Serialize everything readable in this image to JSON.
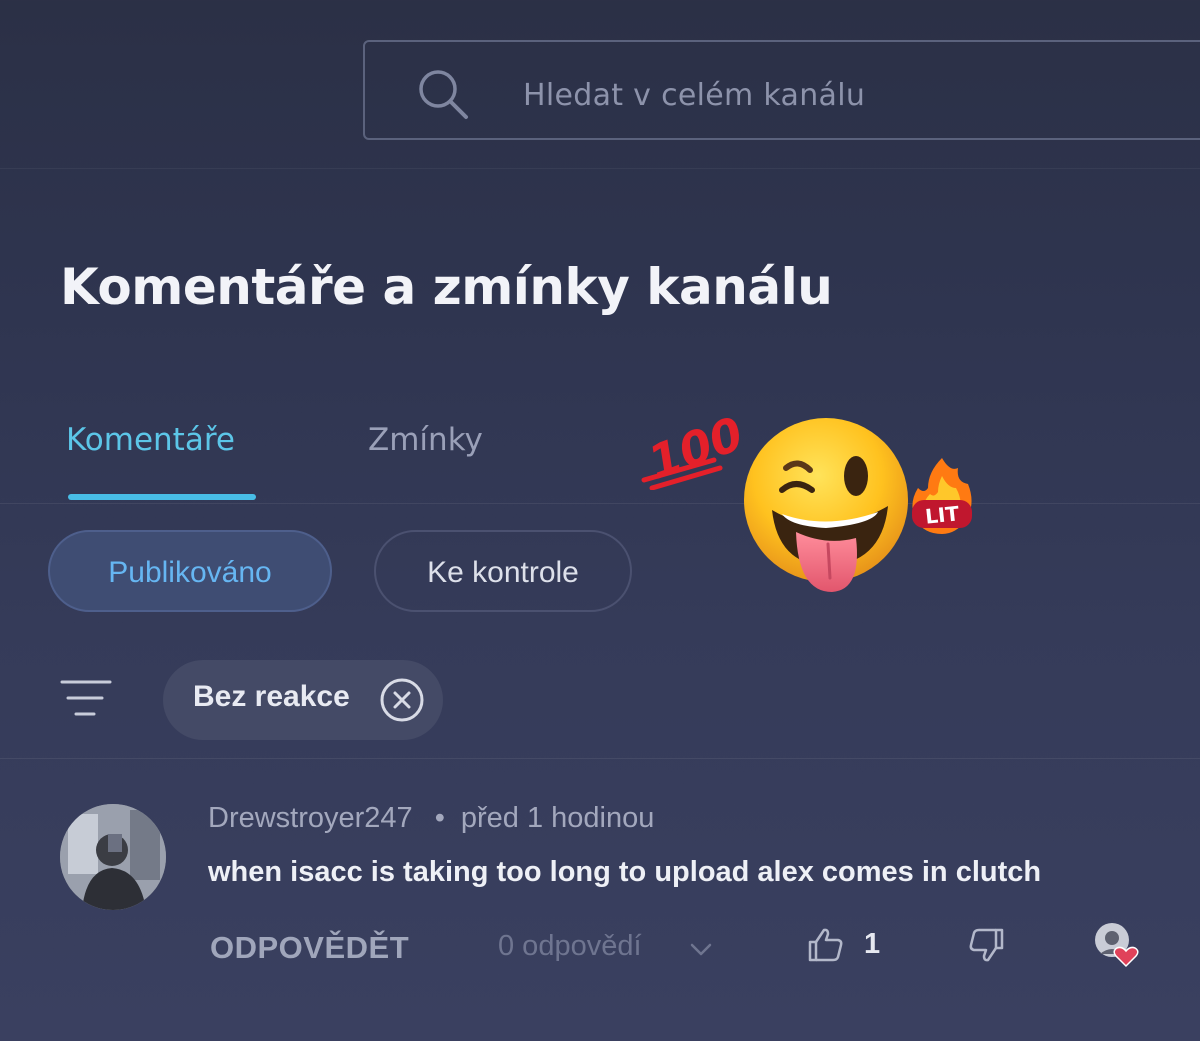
{
  "search": {
    "placeholder": "Hledat v celém kanálu",
    "icon": "search-icon"
  },
  "page": {
    "title": "Komentáře a zmínky kanálu"
  },
  "tabs": [
    {
      "label": "Komentáře",
      "active": true
    },
    {
      "label": "Zmínky",
      "active": false
    }
  ],
  "status_chips": [
    {
      "label": "Publikováno",
      "selected": true
    },
    {
      "label": "Ke kontrole",
      "selected": false
    }
  ],
  "filter": {
    "icon": "filter-icon",
    "active_chip": "Bez reakce",
    "remove_icon": "close-icon"
  },
  "comments": [
    {
      "author": "Drewstroyer247",
      "separator": "•",
      "time": "před 1 hodinou",
      "text": "when isacc is taking too long to upload alex comes in clutch",
      "reply_label": "ODPOVĚDĚT",
      "replies": "0 odpovědí",
      "likes": "1"
    }
  ],
  "stickers": {
    "hundred_text": "100",
    "lit_text": "LIT"
  },
  "colors": {
    "background": "#30364f",
    "accent_tab": "#48bde6",
    "chip_selected_text": "#66b6f2",
    "chip_selected_bg": "#3f4d73",
    "heart": "#e0425a"
  }
}
